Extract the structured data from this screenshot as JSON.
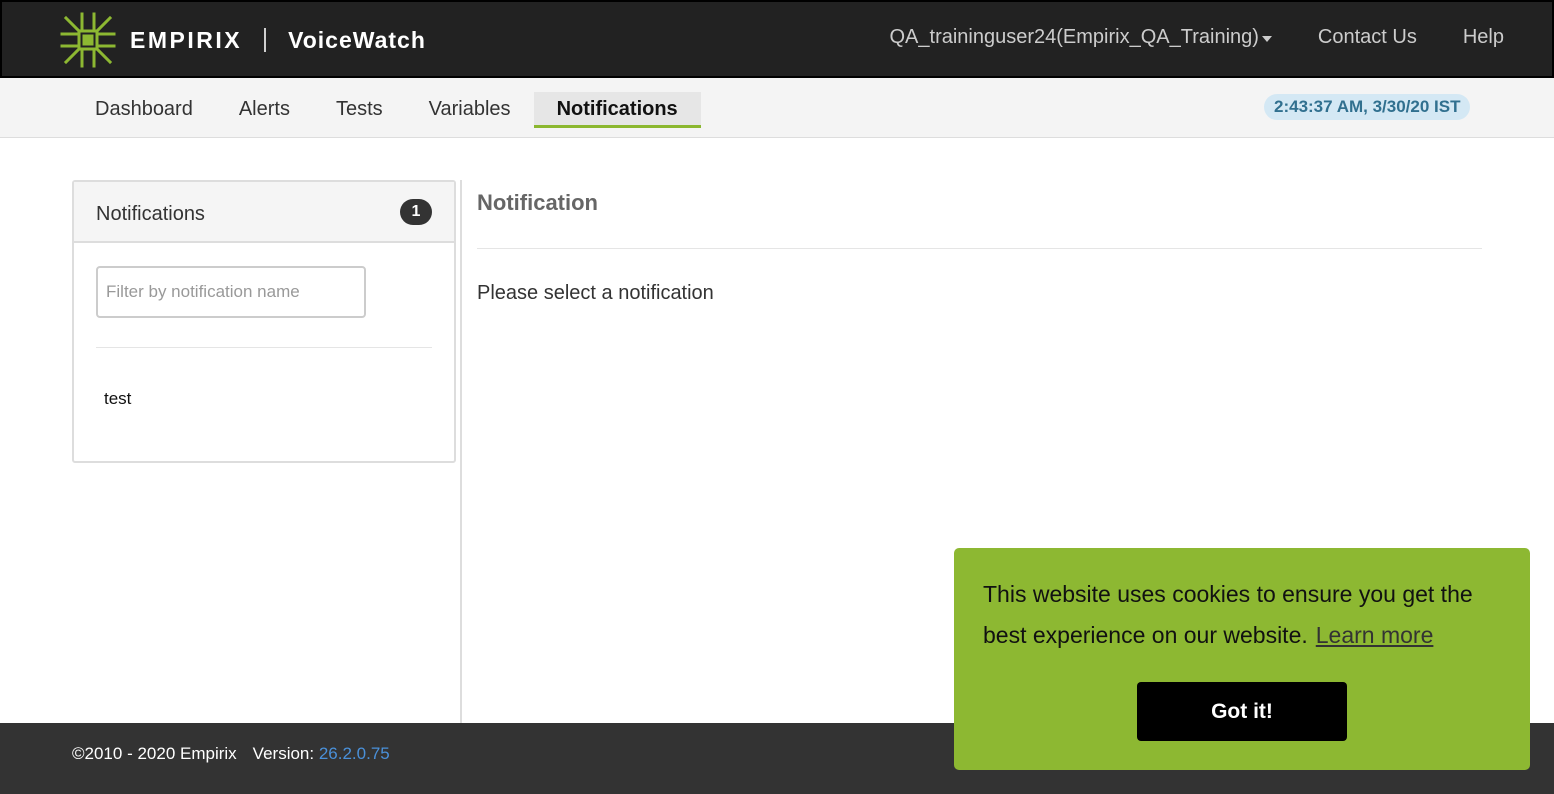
{
  "header": {
    "brand": "EMPIRIX",
    "product": "VoiceWatch",
    "user_menu": "QA_traininguser24(Empirix_QA_Training)",
    "contact_link": "Contact Us",
    "help_link": "Help",
    "logo_icon": "empirix-logo-icon",
    "colors": {
      "background": "#222222",
      "logo_green": "#8db832"
    }
  },
  "subnav": {
    "tabs": [
      {
        "label": "Dashboard",
        "active": false
      },
      {
        "label": "Alerts",
        "active": false
      },
      {
        "label": "Tests",
        "active": false
      },
      {
        "label": "Variables",
        "active": false
      },
      {
        "label": "Notifications",
        "active": true
      }
    ],
    "clock": "2:43:37 AM, 3/30/20 IST",
    "colors": {
      "active_underline": "#8bb72f",
      "clock_bg": "#d4e8f4",
      "clock_text": "#31708f"
    }
  },
  "sidebar": {
    "title": "Notifications",
    "count": "1",
    "filter_placeholder": "Filter by notification name",
    "filter_value": "",
    "items": [
      {
        "label": "test"
      }
    ]
  },
  "detail": {
    "title": "Notification",
    "empty_message": "Please select a notification"
  },
  "footer": {
    "copyright": "©2010 - 2020 Empirix",
    "version_label": "Version:",
    "version_number": "26.2.0.75",
    "colors": {
      "version_link": "#4a90d9"
    }
  },
  "cookie_banner": {
    "message": "This website uses cookies to ensure you get the best experience on our website.",
    "learn_more": "Learn more",
    "accept_label": "Got it!",
    "colors": {
      "background": "#8db832",
      "button": "#000000"
    }
  }
}
